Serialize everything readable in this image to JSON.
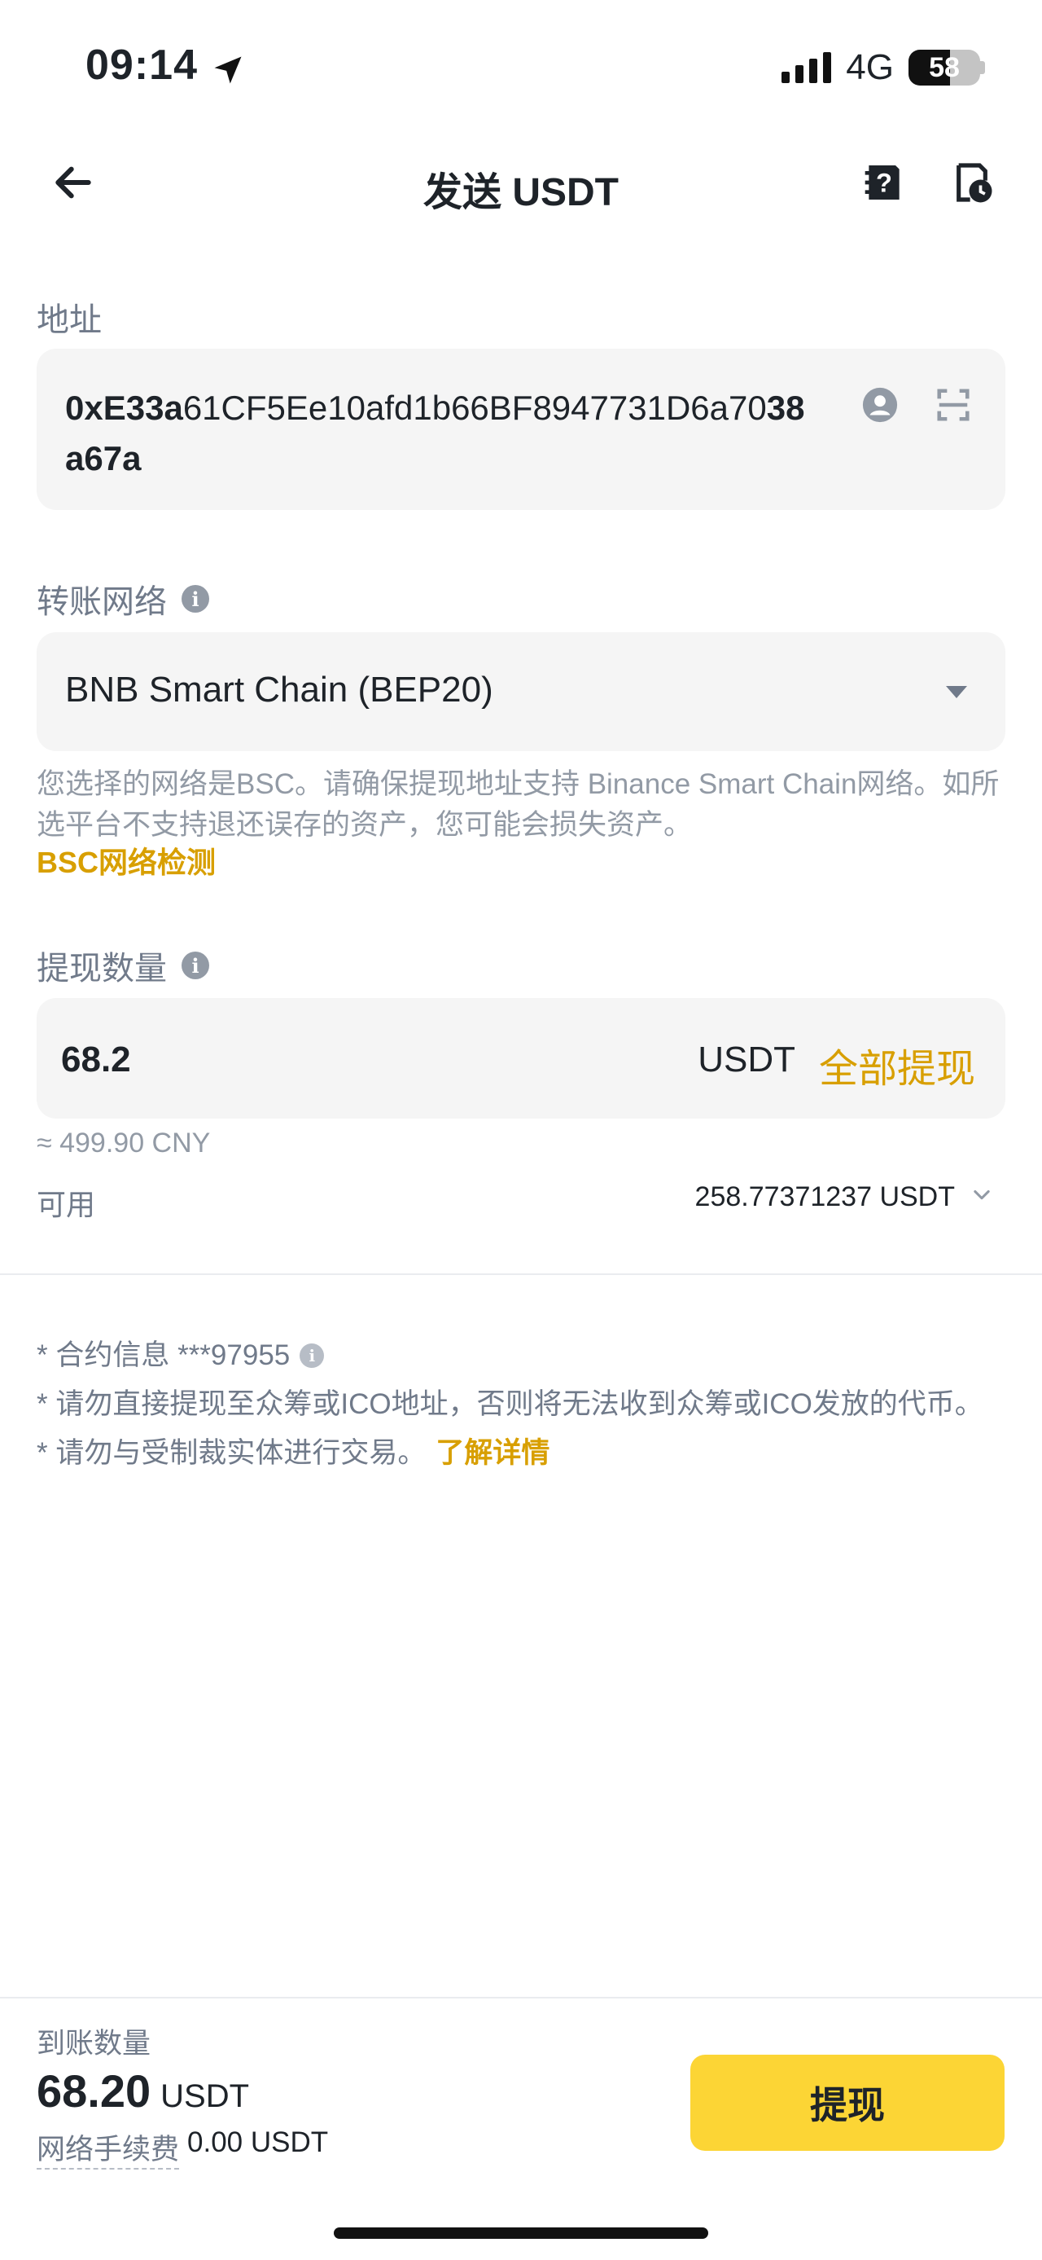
{
  "status_bar": {
    "time": "09:14",
    "network": "4G",
    "battery": "58"
  },
  "header": {
    "title": "发送 USDT"
  },
  "address": {
    "label": "地址",
    "value_bold_start": "0xE33a",
    "value_middle": "61CF5Ee10afd1b66BF8947731D6a7",
    "value_line2_prefix": "0",
    "value_bold_end": "38a67a"
  },
  "network": {
    "label": "转账网络",
    "selected": "BNB Smart Chain (BEP20)",
    "note": "您选择的网络是BSC。请确保提现地址支持 Binance Smart Chain网络。如所选平台不支持退还误存的资产，您可能会损失资产。",
    "check_link": "BSC网络检测"
  },
  "amount": {
    "label": "提现数量",
    "value": "68.2",
    "unit": "USDT",
    "all_label": "全部提现",
    "approx": "≈ 499.90 CNY",
    "available_label": "可用",
    "available_value": "258.77371237 USDT"
  },
  "notices": {
    "contract": "* 合约信息 ***97955",
    "ico": "* 请勿直接提现至众筹或ICO地址，否则将无法收到众筹或ICO发放的代币。",
    "sanction": "* 请勿与受制裁实体进行交易。",
    "learn_more": "了解详情"
  },
  "footer": {
    "receive_label": "到账数量",
    "receive_amount": "68.20",
    "receive_unit": "USDT",
    "fee_label": "网络手续费",
    "fee_value": "0.00 USDT",
    "withdraw_button": "提现"
  },
  "icons": {
    "back": "arrow-left-icon",
    "faq": "question-doc-icon",
    "history": "history-doc-icon",
    "address_book": "contact-icon",
    "scan": "scan-icon",
    "info": "info-icon",
    "dropdown": "caret-down-icon",
    "chevron": "chevron-down-icon",
    "location": "location-arrow-icon"
  },
  "colors": {
    "accent": "#fcd535",
    "link": "#d89f00",
    "box": "#f5f5f5",
    "muted": "#707a8a"
  }
}
